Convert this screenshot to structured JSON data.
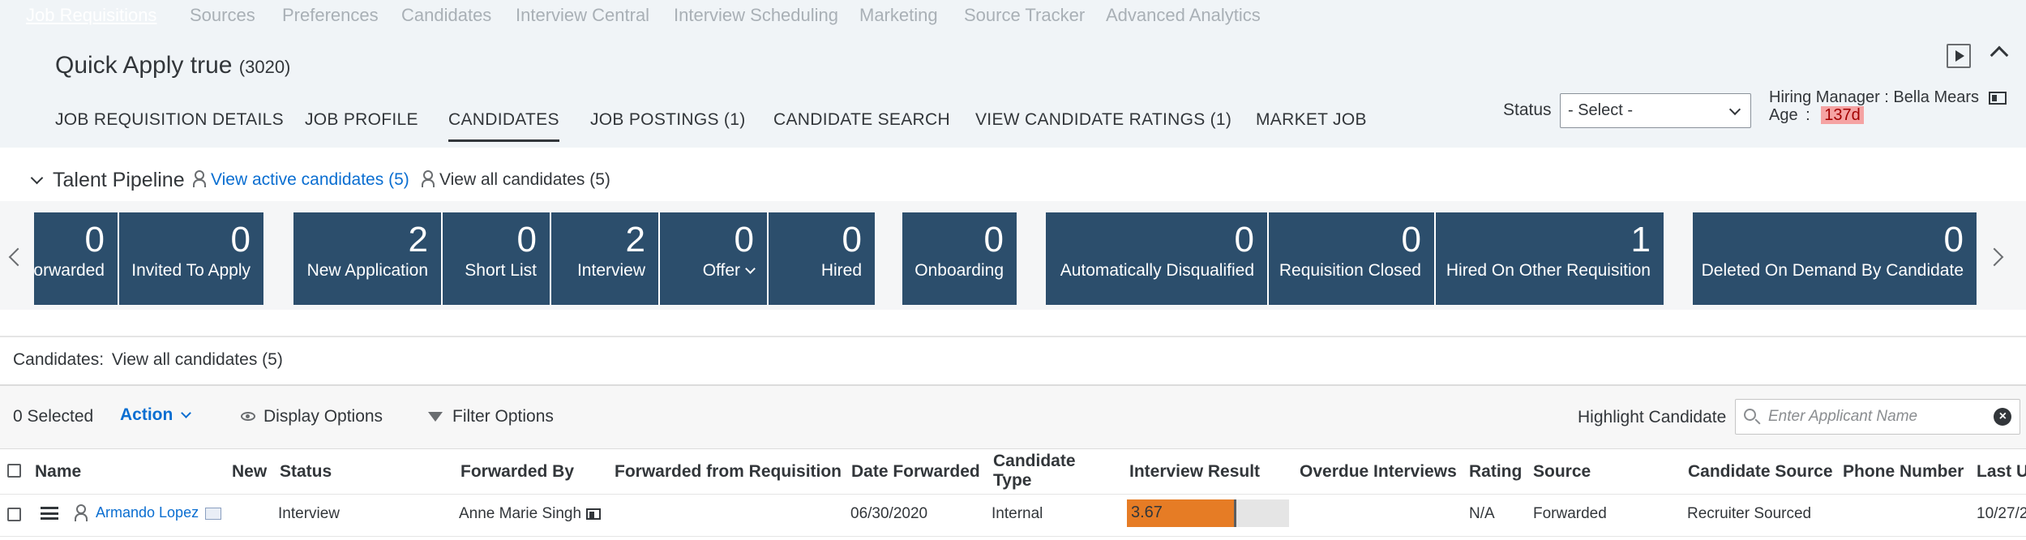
{
  "topnav": [
    "Job Requisitions",
    "Sources",
    "Preferences",
    "Candidates",
    "Interview Central",
    "Interview Scheduling",
    "Marketing",
    "Source Tracker",
    "Advanced Analytics"
  ],
  "header": {
    "title": "Quick Apply true",
    "count": "(3020)"
  },
  "tabs": [
    "JOB REQUISITION DETAILS",
    "JOB PROFILE",
    "CANDIDATES",
    "JOB POSTINGS (1)",
    "CANDIDATE SEARCH",
    "VIEW CANDIDATE RATINGS (1)",
    "MARKET JOB"
  ],
  "selected_tab": "CANDIDATES",
  "status": {
    "label": "Status",
    "value": "- Select -"
  },
  "hiring": {
    "manager_label": "Hiring Manager",
    "manager_sep": ":",
    "manager_name": "Bella Mears",
    "age_label": "Age",
    "age_sep": ":",
    "age_value": "137d"
  },
  "pipeline": {
    "title": "Talent Pipeline",
    "active_link": "View active candidates (5)",
    "all_link": "View all candidates (5)",
    "tiles": [
      {
        "count": "0",
        "label": "Forwarded"
      },
      {
        "count": "0",
        "label": "Invited To Apply"
      },
      {
        "count": "2",
        "label": "New Application"
      },
      {
        "count": "0",
        "label": "Short List"
      },
      {
        "count": "2",
        "label": "Interview"
      },
      {
        "count": "0",
        "label": "Offer"
      },
      {
        "count": "0",
        "label": "Hired"
      },
      {
        "count": "0",
        "label": "Onboarding"
      },
      {
        "count": "0",
        "label": "Automatically Disqualified"
      },
      {
        "count": "0",
        "label": "Requisition Closed"
      },
      {
        "count": "1",
        "label": "Hired On Other Requisition"
      },
      {
        "count": "0",
        "label": "Deleted On Demand By Candidate"
      }
    ]
  },
  "candidates": {
    "title_label": "Candidates:",
    "title_value": "View all candidates (5)",
    "selected": "0 Selected",
    "action": "Action",
    "display_options": "Display Options",
    "filter_options": "Filter Options",
    "highlight_label": "Highlight Candidate",
    "highlight_placeholder": "Enter Applicant Name"
  },
  "table": {
    "columns": [
      "Name",
      "New",
      "Status",
      "Forwarded By",
      "Forwarded from Requisition",
      "Date Forwarded",
      "Candidate Type",
      "Interview Result",
      "Overdue Interviews",
      "Rating",
      "Source",
      "Candidate Source",
      "Phone Number",
      "Last U"
    ],
    "rows": [
      {
        "name": "Armando Lopez",
        "new": "",
        "status": "Interview",
        "forwarded_by": "Anne Marie Singh",
        "forwarded_from": "",
        "date_forwarded": "06/30/2020",
        "candidate_type": "Internal",
        "interview_result": "3.67",
        "interview_result_fraction": 0.66,
        "overdue": "",
        "rating": "N/A",
        "source": "Forwarded",
        "candidate_source": "Recruiter Sourced",
        "phone": "",
        "last_updated": "10/27/2"
      }
    ]
  },
  "colors": {
    "tile_bg": "#2c4e6c",
    "link": "#0a6ed1",
    "bar": "#e67c25",
    "age_badge": "#f5a3a3"
  }
}
